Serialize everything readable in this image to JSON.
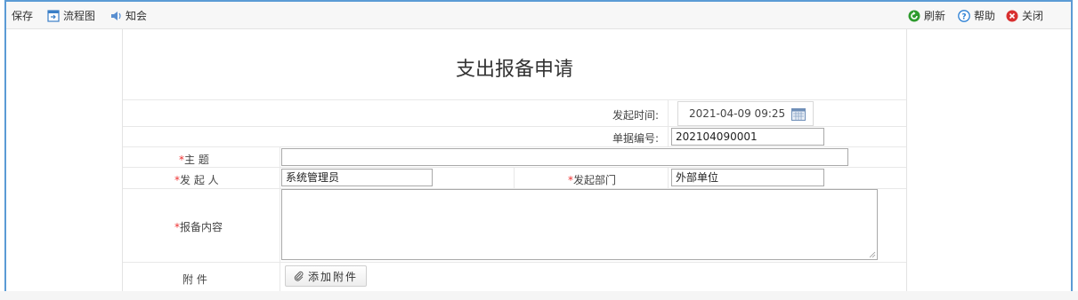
{
  "toolbar": {
    "left": [
      {
        "label": "保存",
        "icon": "save"
      },
      {
        "label": "流程图",
        "icon": "flowchart-icon"
      },
      {
        "label": "知会",
        "icon": "notify-speaker-icon"
      }
    ],
    "right": [
      {
        "label": "刷新",
        "icon": "refresh-icon",
        "color": "#2e9b2e"
      },
      {
        "label": "帮助",
        "icon": "help-icon",
        "color": "#2a7fd4"
      },
      {
        "label": "关闭",
        "icon": "close-icon",
        "color": "#d83030"
      }
    ]
  },
  "form": {
    "title": "支出报备申请",
    "start_time_label": "发起时间:",
    "start_time_value": "2021-04-09 09:25",
    "doc_no_label": "单据编号:",
    "doc_no_value": "202104090001",
    "subject_label": "主 题",
    "subject_value": "",
    "initiator_label": "发 起 人",
    "initiator_value": "系统管理员",
    "dept_label": "发起部门",
    "dept_value": "外部单位",
    "content_label": "报备内容",
    "content_value": "",
    "attachment_label": "附 件",
    "attach_button": "添加附件",
    "required_mark": "*"
  }
}
